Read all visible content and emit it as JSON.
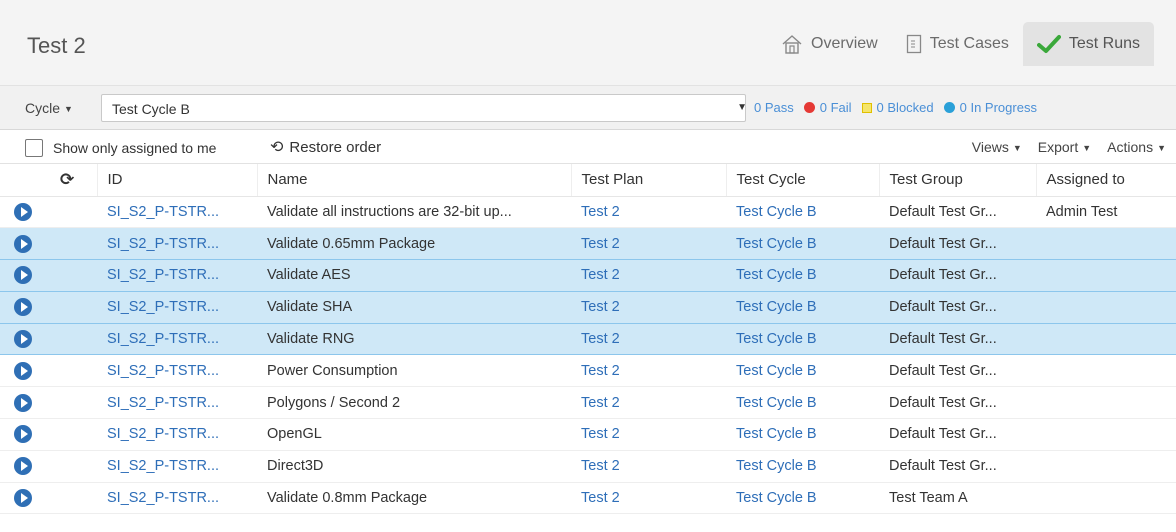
{
  "page": {
    "title": "Test 2"
  },
  "nav": [
    {
      "label": "Overview",
      "icon": "home-icon"
    },
    {
      "label": "Test Cases",
      "icon": "document-icon"
    },
    {
      "label": "Test Runs",
      "icon": "checkmark-icon"
    }
  ],
  "cycle": {
    "label": "Cycle",
    "selected": "Test Cycle B",
    "stats": [
      {
        "text": "0 Pass",
        "color": "#4caf50"
      },
      {
        "text": "0 Fail",
        "color": "#e53935"
      },
      {
        "text": "0 Blocked",
        "color": "#f5e56b"
      },
      {
        "text": "0 In Progress",
        "color": "#2aa0d8"
      }
    ]
  },
  "toolbar": {
    "show_assigned": "Show only assigned to me",
    "restore": "Restore order",
    "views": "Views",
    "export": "Export",
    "actions": "Actions"
  },
  "columns": [
    "ID",
    "Name",
    "Test Plan",
    "Test Cycle",
    "Test Group",
    "Assigned to"
  ],
  "rows": [
    {
      "id": "SI_S2_P-TSTR...",
      "name": "Validate all instructions are 32-bit up...",
      "plan": "Test 2",
      "cycle": "Test Cycle B",
      "group": "Default Test Gr...",
      "assigned": "Admin Test",
      "selected": false
    },
    {
      "id": "SI_S2_P-TSTR...",
      "name": "Validate 0.65mm Package",
      "plan": "Test 2",
      "cycle": "Test Cycle B",
      "group": "Default Test Gr...",
      "assigned": "",
      "selected": true
    },
    {
      "id": "SI_S2_P-TSTR...",
      "name": "Validate AES",
      "plan": "Test 2",
      "cycle": "Test Cycle B",
      "group": "Default Test Gr...",
      "assigned": "",
      "selected": true
    },
    {
      "id": "SI_S2_P-TSTR...",
      "name": "Validate SHA",
      "plan": "Test 2",
      "cycle": "Test Cycle B",
      "group": "Default Test Gr...",
      "assigned": "",
      "selected": true
    },
    {
      "id": "SI_S2_P-TSTR...",
      "name": "Validate RNG",
      "plan": "Test 2",
      "cycle": "Test Cycle B",
      "group": "Default Test Gr...",
      "assigned": "",
      "selected": true
    },
    {
      "id": "SI_S2_P-TSTR...",
      "name": "Power Consumption",
      "plan": "Test 2",
      "cycle": "Test Cycle B",
      "group": "Default Test Gr...",
      "assigned": "",
      "selected": false
    },
    {
      "id": "SI_S2_P-TSTR...",
      "name": "Polygons / Second 2",
      "plan": "Test 2",
      "cycle": "Test Cycle B",
      "group": "Default Test Gr...",
      "assigned": "",
      "selected": false
    },
    {
      "id": "SI_S2_P-TSTR...",
      "name": "OpenGL",
      "plan": "Test 2",
      "cycle": "Test Cycle B",
      "group": "Default Test Gr...",
      "assigned": "",
      "selected": false
    },
    {
      "id": "SI_S2_P-TSTR...",
      "name": "Direct3D",
      "plan": "Test 2",
      "cycle": "Test Cycle B",
      "group": "Default Test Gr...",
      "assigned": "",
      "selected": false
    },
    {
      "id": "SI_S2_P-TSTR...",
      "name": "Validate 0.8mm Package",
      "plan": "Test 2",
      "cycle": "Test Cycle B",
      "group": "Test Team A",
      "assigned": "",
      "selected": false
    }
  ]
}
